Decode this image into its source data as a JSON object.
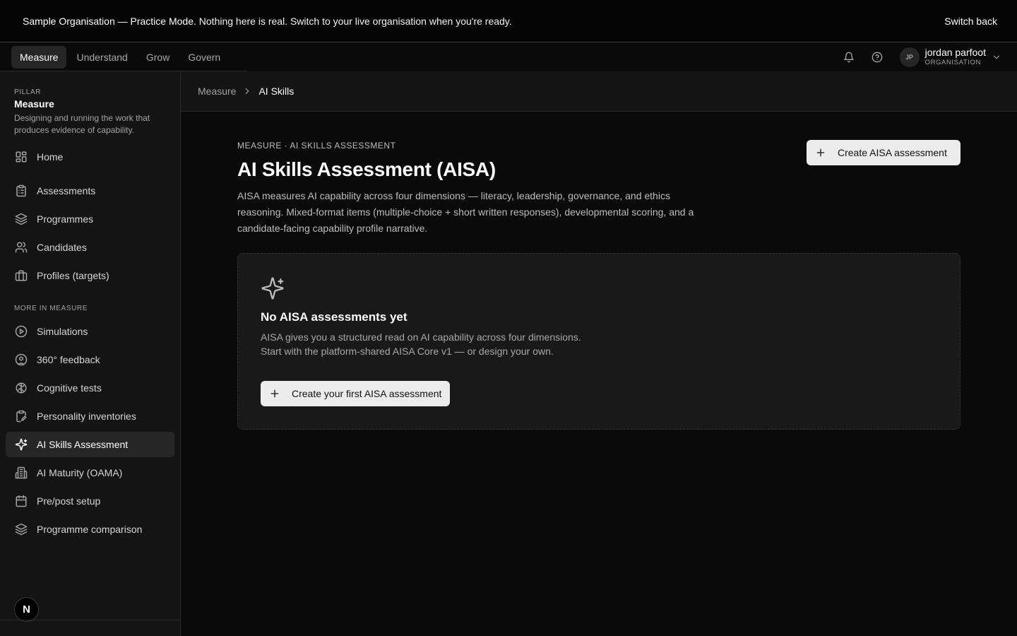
{
  "banner": {
    "strong": "Sample Organisation — Practice Mode.",
    "message": " Nothing here is real. Switch to your live organisation when you're ready.",
    "switch_label": "Switch back"
  },
  "topnav": {
    "tabs": [
      {
        "label": "Measure",
        "active": true
      },
      {
        "label": "Understand"
      },
      {
        "label": "Grow"
      },
      {
        "label": "Govern"
      }
    ],
    "icons": [
      "bell-icon",
      "help-icon"
    ],
    "user": {
      "initials": "JP",
      "name": "jordan parfoot",
      "role": "ORGANISATION"
    }
  },
  "sidebar": {
    "pillar_label": "PILLAR",
    "pillar_title": "Measure",
    "pillar_desc": "Designing and running the work that produces evidence of capability.",
    "items": [
      {
        "label": "Home",
        "icon": "grid-icon"
      },
      {
        "label": "Assessments",
        "icon": "clipboard-icon"
      },
      {
        "label": "Programmes",
        "icon": "layers-icon"
      },
      {
        "label": "Candidates",
        "icon": "users-icon"
      },
      {
        "label": "Profiles (targets)",
        "icon": "briefcase-icon"
      }
    ],
    "more_label": "MORE IN MEASURE",
    "more_items": [
      {
        "label": "Simulations",
        "icon": "play-circle-icon"
      },
      {
        "label": "360° feedback",
        "icon": "user-circle-icon"
      },
      {
        "label": "Cognitive tests",
        "icon": "brain-icon"
      },
      {
        "label": "Personality inventories",
        "icon": "clipboard-edit-icon"
      },
      {
        "label": "AI Skills Assessment",
        "icon": "sparkles-icon",
        "active": true
      },
      {
        "label": "AI Maturity (OAMA)",
        "icon": "building-icon"
      },
      {
        "label": "Pre/post setup",
        "icon": "calendar-icon"
      },
      {
        "label": "Programme comparison",
        "icon": "layers-icon"
      }
    ],
    "logo": "N"
  },
  "breadcrumb": {
    "parent": "Measure",
    "current": "AI Skills"
  },
  "main": {
    "eyebrow": "MEASURE · AI SKILLS ASSESSMENT",
    "title": "AI Skills Assessment (AISA)",
    "description": "AISA measures AI capability across four dimensions — literacy, leadership, governance, and ethics reasoning. Mixed-format items (multiple-choice + short written responses), developmental scoring, and a candidate-facing capability profile narrative.",
    "create_label": "Create AISA assessment",
    "empty": {
      "title": "No AISA assessments yet",
      "description": "AISA gives you a structured read on AI capability across four dimensions. Start with the platform-shared AISA Core v1 — or design your own.",
      "button_label": "Create your first AISA assessment"
    }
  }
}
